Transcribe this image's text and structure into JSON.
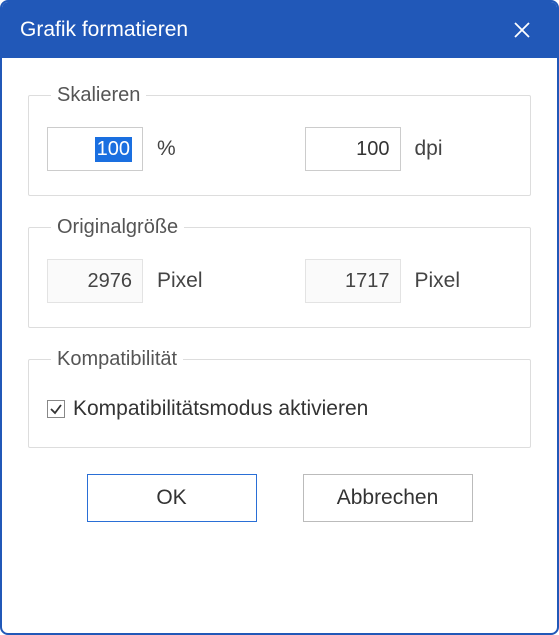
{
  "dialog": {
    "title": "Grafik formatieren"
  },
  "scaling": {
    "legend": "Skalieren",
    "percent_value": "100",
    "percent_unit": "%",
    "dpi_value": "100",
    "dpi_unit": "dpi"
  },
  "original": {
    "legend": "Originalgröße",
    "width_value": "2976",
    "width_unit": "Pixel",
    "height_value": "1717",
    "height_unit": "Pixel"
  },
  "compat": {
    "legend": "Kompatibilität",
    "checkbox_label": "Kompatibilitätsmodus aktivieren",
    "checked": true
  },
  "buttons": {
    "ok": "OK",
    "cancel": "Abbrechen"
  }
}
